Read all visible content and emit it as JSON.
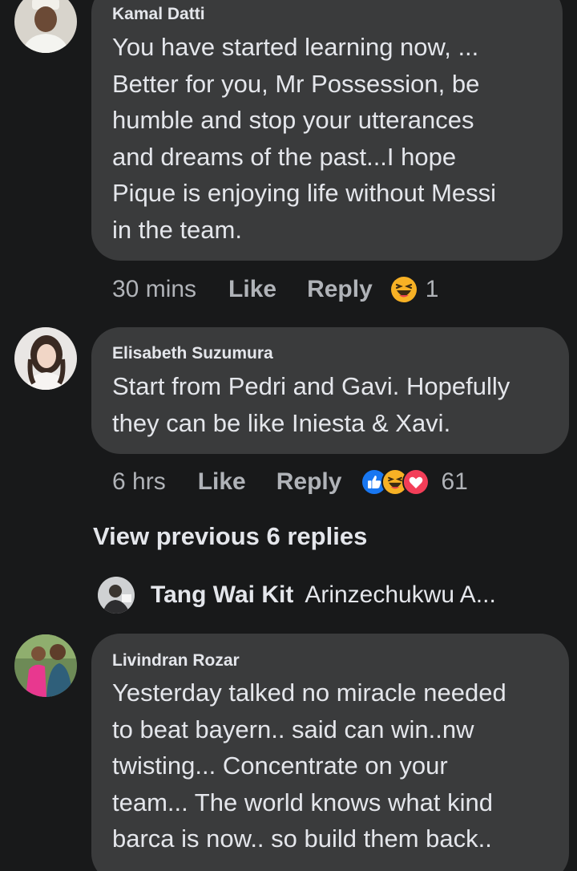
{
  "comments": [
    {
      "author": "Kamal Datti",
      "lines": [
        "You have started learning now, ...",
        "Better for you, Mr Possession, be",
        "humble and stop your utterances",
        "and dreams of the past...I hope",
        "Pique is enjoying life without Messi",
        "in the team."
      ],
      "time": "30 mins",
      "like_label": "Like",
      "reply_label": "Reply",
      "reactions": [
        "haha-icon"
      ],
      "reaction_count": "1"
    },
    {
      "author": "Elisabeth Suzumura",
      "lines": [
        "Start from Pedri and Gavi. Hopefully",
        "they can be like Iniesta & Xavi."
      ],
      "time": "6 hrs",
      "like_label": "Like",
      "reply_label": "Reply",
      "reactions": [
        "like-icon",
        "haha-icon",
        "love-icon"
      ],
      "reaction_count": "61"
    },
    {
      "author": "Livindran Rozar",
      "lines": [
        "Yesterday talked no miracle needed",
        "to beat bayern.. said can win..nw",
        "twisting... Concentrate on your",
        "team... The world knows what kind",
        "barca is now.. so build them back.."
      ]
    }
  ],
  "view_previous": "View previous 6 replies",
  "collapsed_reply": {
    "name": "Tang Wai Kit",
    "snippet": "Arinzechukwu A..."
  },
  "colors": {
    "background": "#18191a",
    "bubble": "#3a3b3c",
    "text": "#e4e6eb",
    "meta": "#b0b3b8",
    "like_blue": "#1877f2",
    "love_red": "#f33e58",
    "haha_yellow": "#f7b125"
  }
}
